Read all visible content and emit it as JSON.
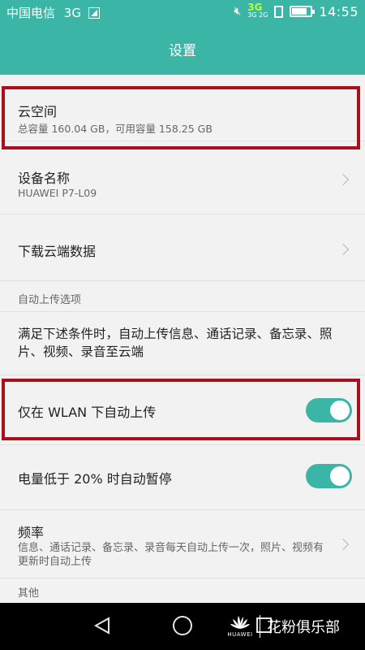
{
  "status_bar": {
    "carrier": "中国电信",
    "network": "3G",
    "net_primary": "3G",
    "net_secondary": "3G 2G",
    "time": "14:55"
  },
  "header": {
    "title": "设置"
  },
  "items": {
    "cloud_space": {
      "title": "云空间",
      "subtitle": "总容量 160.04 GB，可用容量 158.25 GB"
    },
    "device_name": {
      "title": "设备名称",
      "subtitle": "HUAWEI P7-L09"
    },
    "download_cloud": {
      "title": "下载云端数据"
    },
    "auto_upload_section": "自动上传选项",
    "auto_upload_desc": "满足下述条件时，自动上传信息、通话记录、备忘录、照片、视频、录音至云端",
    "wlan_only": {
      "title": "仅在 WLAN 下自动上传",
      "enabled": true
    },
    "low_battery": {
      "title": "电量低于 20% 时自动暂停",
      "enabled": true
    },
    "frequency": {
      "title": "频率",
      "subtitle": "信息、通话记录、备忘录、录音每天自动上传一次，照片、视频有更新时自动上传"
    },
    "other_section": "其他"
  },
  "watermark": {
    "brand": "HUAWEI",
    "text": "花粉俱乐部"
  },
  "colors": {
    "accent": "#3bb6a6",
    "highlight": "#a8101e",
    "navbar": "#000000"
  },
  "icons": [
    "signal-icon",
    "mute-icon",
    "sim-icon",
    "battery-icon",
    "chevron-right-icon",
    "back-icon",
    "home-icon",
    "recent-apps-icon",
    "huawei-logo-icon"
  ]
}
